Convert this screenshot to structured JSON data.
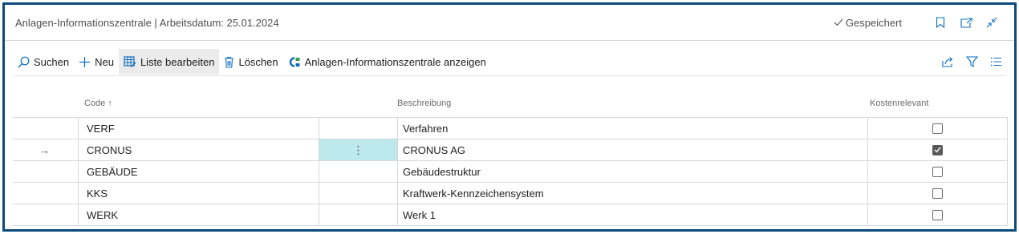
{
  "title": "Anlagen-Informationszentrale | Arbeitsdatum: 25.01.2024",
  "status": "Gespeichert",
  "actions": {
    "search": "Suchen",
    "new": "Neu",
    "edit_list": "Liste bearbeiten",
    "delete": "Löschen",
    "show": "Anlagen-Informationszentrale anzeigen"
  },
  "columns": {
    "code": "Code ↑",
    "description": "Beschreibung",
    "cost_relevant": "Kostenrelevant"
  },
  "rows": [
    {
      "code": "VERF",
      "description": "Verfahren",
      "cost_relevant": false
    },
    {
      "code": "CRONUS",
      "description": "CRONUS AG",
      "cost_relevant": true
    },
    {
      "code": "GEBÄUDE",
      "description": "Gebäudestruktur",
      "cost_relevant": false
    },
    {
      "code": "KKS",
      "description": "Kraftwerk-Kennzeichensystem",
      "cost_relevant": false
    },
    {
      "code": "WERK",
      "description": "Werk 1",
      "cost_relevant": false
    }
  ],
  "selected_row": 1,
  "row_marker": "→",
  "row_menu": "⋮",
  "colors": {
    "accent": "#0b4a7a",
    "selection": "#bde8ec"
  }
}
